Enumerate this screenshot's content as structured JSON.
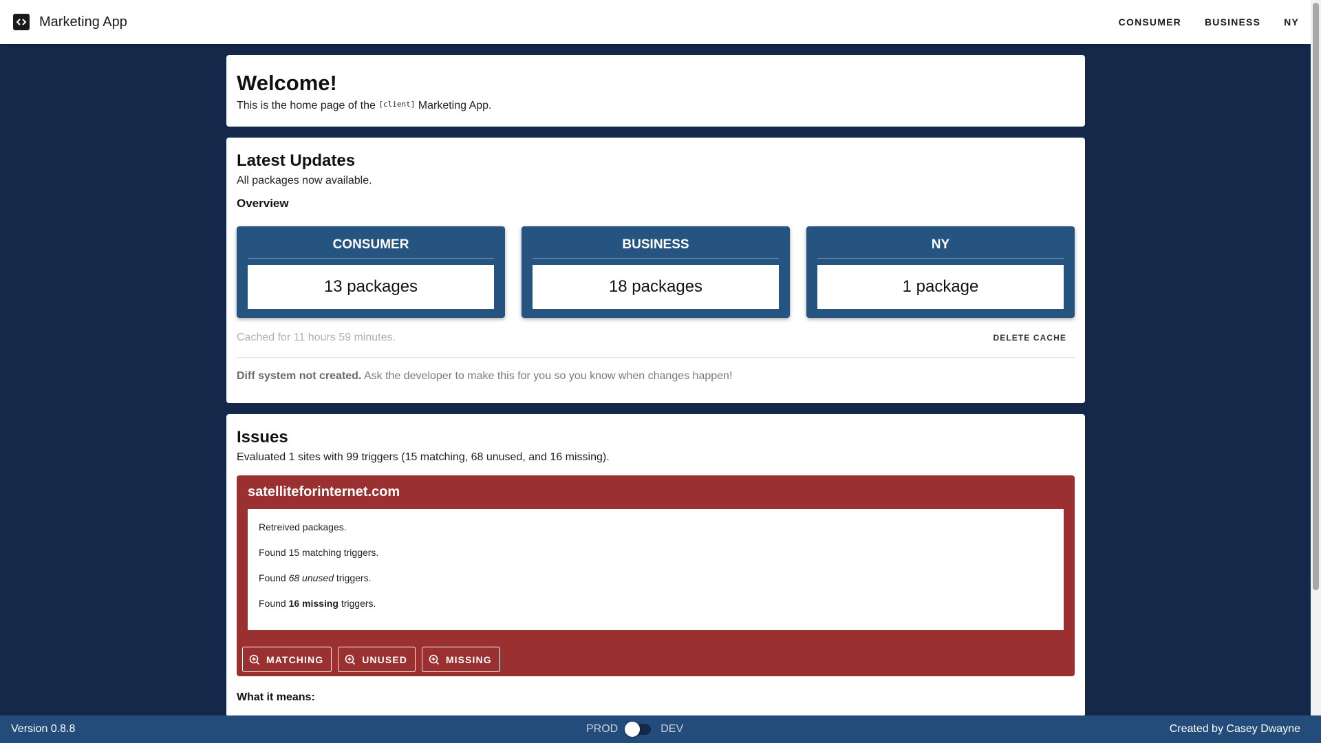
{
  "header": {
    "app_title": "Marketing App",
    "nav": [
      "CONSUMER",
      "BUSINESS",
      "NY"
    ]
  },
  "welcome": {
    "title": "Welcome!",
    "text_before": "This is the home page of the ",
    "client_tag": "[client]",
    "text_after": " Marketing App."
  },
  "updates": {
    "title": "Latest Updates",
    "status": "All packages now available.",
    "overview_label": "Overview",
    "packages": [
      {
        "name": "CONSUMER",
        "count_text": "13 packages"
      },
      {
        "name": "BUSINESS",
        "count_text": "18 packages"
      },
      {
        "name": "NY",
        "count_text": "1 package"
      }
    ],
    "cache_text": "Cached for 11 hours 59 minutes.",
    "delete_cache_label": "DELETE CACHE",
    "diff_bold": "Diff system not created.",
    "diff_text": " Ask the developer to make this for you so you know when changes happen!"
  },
  "issues": {
    "title": "Issues",
    "summary": "Evaluated 1 sites with 99 triggers (15 matching, 68 unused, and 16 missing).",
    "site": {
      "name": "satelliteforinternet.com",
      "line1": "Retreived packages.",
      "line2": "Found 15 matching triggers.",
      "line3_a": "Found ",
      "line3_em": "68 unused",
      "line3_b": " triggers.",
      "line4_a": "Found ",
      "line4_strong": "16 missing",
      "line4_b": " triggers."
    },
    "actions": [
      "MATCHING",
      "UNUSED",
      "MISSING"
    ],
    "what_it_means": "What it means:"
  },
  "footer": {
    "version": "Version 0.8.8",
    "env_left": "PROD",
    "env_right": "DEV",
    "credit": "Created by Casey Dwayne"
  },
  "colors": {
    "background": "#15284a",
    "package_card": "#265481",
    "site_panel": "#9b3030",
    "footer": "#234c7a"
  }
}
